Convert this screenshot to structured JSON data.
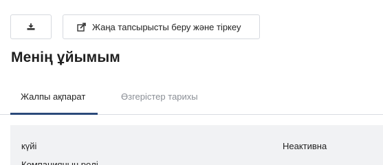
{
  "toolbar": {
    "download_icon": "download-icon",
    "submit_icon": "external-edit-icon",
    "submit_label": "Жаңа тапсырысты беру және тіркеу"
  },
  "page": {
    "title": "Менің ұйымым"
  },
  "tabs": [
    {
      "label": "Жалпы ақпарат",
      "active": true
    },
    {
      "label": "Өзгерістер тарихы",
      "active": false
    }
  ],
  "details": {
    "rows": [
      {
        "label": "күйі",
        "value": "Неактивна"
      },
      {
        "label": "Компанияның рөлі",
        "value": ""
      }
    ]
  },
  "colors": {
    "active_tab_underline": "#2b4a7a",
    "inactive_tab_text": "#8b8f96",
    "panel_background": "#f1f2f4",
    "button_border": "#d6d9de"
  }
}
